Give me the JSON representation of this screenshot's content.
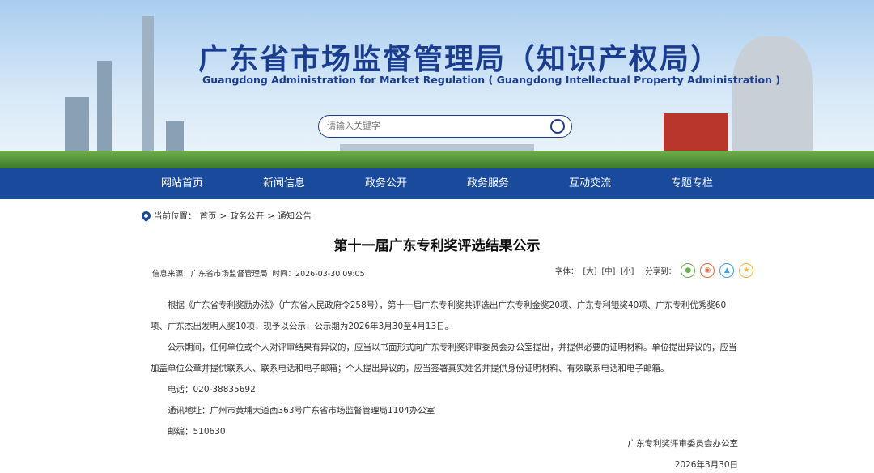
{
  "header": {
    "title_cn": "广东省市场监督管理局（知识产权局）",
    "title_en": "Guangdong Administration for Market Regulation ( Guangdong Intellectual Property Administration )",
    "search_placeholder": "请输入关键字"
  },
  "nav": [
    "网站首页",
    "新闻信息",
    "政务公开",
    "政务服务",
    "互动交流",
    "专题专栏"
  ],
  "breadcrumb": {
    "label": "当前位置：",
    "items": [
      "首页",
      ">",
      "政务公开",
      ">",
      "通知公告"
    ]
  },
  "article": {
    "title": "第十一届广东专利奖评选结果公示",
    "meta": "信息来源：广东省市场监督管理局  时间：2026-03-30 09:05",
    "font_label": "字体：",
    "font_sizes": [
      "[大]",
      "[中]",
      "[小]"
    ],
    "share_label": "分享到：",
    "paragraphs": [
      "根据《广东省专利奖励办法》（广东省人民政府令258号），第十一届广东专利奖共评选出广东专利金奖20项、广东专利银奖40项、广东专利优秀奖60项、广东杰出发明人奖10项，现予以公示，公示期为2026年3月30至4月13日。",
      "公示期间，任何单位或个人对评审结果有异议的，应当以书面形式向广东专利奖评审委员会办公室提出，并提供必要的证明材料。单位提出异议的，应当加盖单位公章并提供联系人、联系电话和电子邮箱；个人提出异议的，应当签署真实姓名并提供身份证明材料、有效联系电话和电子邮箱。",
      "电话：020-38835692",
      "通讯地址：广州市黄埔大道西363号广东省市场监督管理局1104办公室",
      "邮编：510630"
    ],
    "signature": "广东专利奖评审委员会办公室",
    "date": "2026年3月30日"
  },
  "colors": {
    "nav": "#1a4a9c",
    "title": "#1b3d8f"
  }
}
